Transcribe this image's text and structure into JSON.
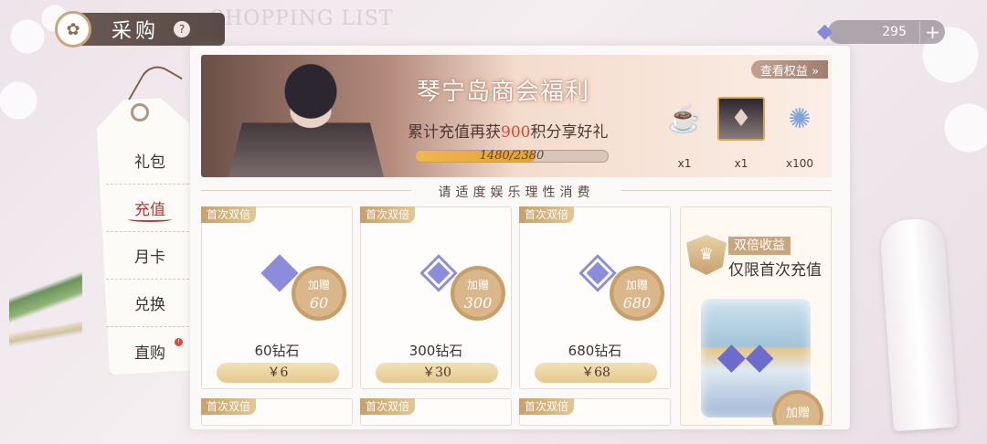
{
  "header": {
    "title": "采购",
    "help": "?",
    "watermark": "SHOPPING LIST"
  },
  "currency": {
    "amount": "295",
    "plus": "+"
  },
  "nav": [
    {
      "label": "礼包"
    },
    {
      "label": "充值"
    },
    {
      "label": "月卡"
    },
    {
      "label": "兑换"
    },
    {
      "label": "直购",
      "dot": "!"
    }
  ],
  "banner": {
    "title": "琴宁岛商会福利",
    "sub_pre": "累计充值再获",
    "sub_hl": "900",
    "sub_post": "积分享好礼",
    "progress_text": "1480/2380",
    "progress_current": 1480,
    "progress_total": 2380,
    "view_label": "查看权益 »",
    "rewards": [
      {
        "icon": "coffee-icon",
        "qty": "x1"
      },
      {
        "icon": "character-card-icon",
        "qty": "x1"
      },
      {
        "icon": "coin-icon",
        "qty": "x100"
      }
    ]
  },
  "notice": "请适度娱乐理性消费",
  "cards": [
    {
      "badge": "首次双倍",
      "bonus_label": "加赠",
      "bonus": "60",
      "name": "60钻石",
      "price": "￥6"
    },
    {
      "badge": "首次双倍",
      "bonus_label": "加赠",
      "bonus": "300",
      "name": "300钻石",
      "price": "￥30"
    },
    {
      "badge": "首次双倍",
      "bonus_label": "加赠",
      "bonus": "680",
      "name": "680钻石",
      "price": "￥68"
    }
  ],
  "cards_row2": [
    {
      "badge": "首次双倍"
    },
    {
      "badge": "首次双倍"
    },
    {
      "badge": "首次双倍"
    }
  ],
  "promo": {
    "tag": "双倍收益",
    "title": "仅限首次充值",
    "bonus_label": "加赠"
  },
  "colors": {
    "accent_red": "#b33a32",
    "gold": "#c9a77a",
    "highlight": "#e4452e"
  }
}
